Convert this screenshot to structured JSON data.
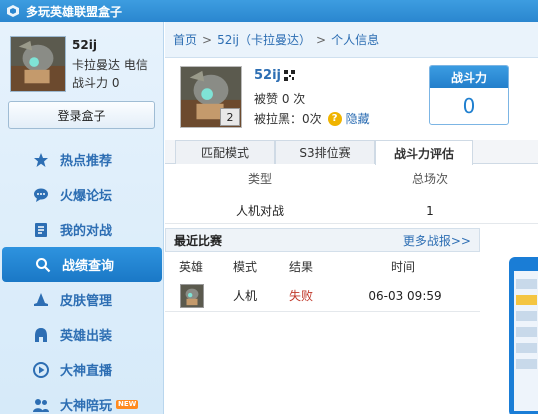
{
  "app": {
    "title": "多玩英雄联盟盒子"
  },
  "profile": {
    "name": "52ij",
    "server": "卡拉曼达 电信",
    "power_line": "战斗力 0"
  },
  "sidebar": {
    "login_label": "登录盒子",
    "items": [
      {
        "label": "热点推荐",
        "icon": "star-icon"
      },
      {
        "label": "火爆论坛",
        "icon": "chat-icon"
      },
      {
        "label": "我的对战",
        "icon": "battle-book-icon"
      },
      {
        "label": "战绩查询",
        "icon": "search-icon",
        "active": true
      },
      {
        "label": "皮肤管理",
        "icon": "hat-icon"
      },
      {
        "label": "英雄出装",
        "icon": "helmet-icon"
      },
      {
        "label": "大神直播",
        "icon": "play-icon"
      },
      {
        "label": "大神陪玩",
        "icon": "people-icon",
        "badge": "NEW"
      }
    ]
  },
  "breadcrumb": {
    "home": "首页",
    "player": "52ij（卡拉曼达）",
    "page": "个人信息"
  },
  "player": {
    "name": "52ij",
    "level": "2",
    "liked": "被赞 0 次",
    "blacked": "被拉黑：0次",
    "hide_link": "隐藏"
  },
  "power_box": {
    "title": "战斗力",
    "value": "0"
  },
  "tabs": [
    {
      "label": "匹配模式"
    },
    {
      "label": "S3排位赛"
    },
    {
      "label": "战斗力评估",
      "active": true
    }
  ],
  "stats": {
    "headers": [
      "类型",
      "总场次"
    ],
    "rows": [
      {
        "type": "人机对战",
        "total": "1"
      }
    ]
  },
  "recent": {
    "title": "最近比赛",
    "more": "更多战报>>",
    "headers": [
      "英雄",
      "模式",
      "结果",
      "时间"
    ],
    "matches": [
      {
        "mode": "人机",
        "result": "失败",
        "time": "06-03 09:59"
      }
    ]
  },
  "colors": {
    "accent": "#2d6eb3",
    "active_nav": "#1f82cf",
    "lose": "#c0392b"
  }
}
